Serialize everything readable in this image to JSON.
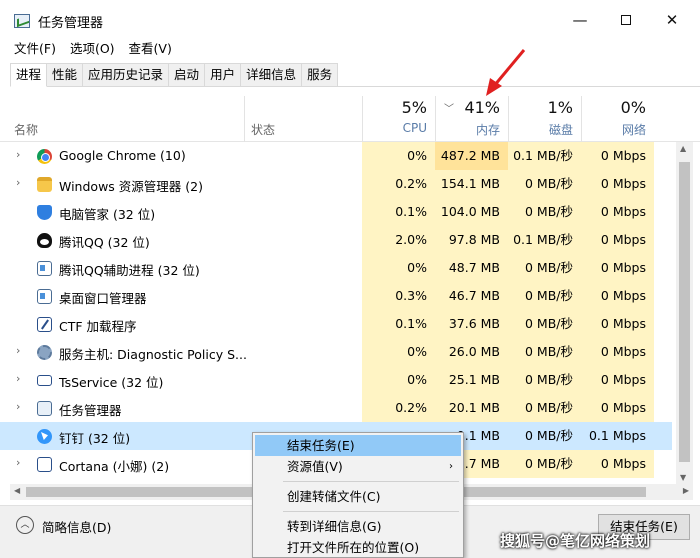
{
  "window": {
    "title": "任务管理器"
  },
  "menu": [
    "文件(F)",
    "选项(O)",
    "查看(V)"
  ],
  "tabs": [
    "进程",
    "性能",
    "应用历史记录",
    "启动",
    "用户",
    "详细信息",
    "服务"
  ],
  "columns": {
    "name": "名称",
    "status": "状态",
    "cpu": {
      "pct": "5%",
      "label": "CPU"
    },
    "memory": {
      "pct": "41%",
      "label": "内存"
    },
    "disk": {
      "pct": "1%",
      "label": "磁盘"
    },
    "network": {
      "pct": "0%",
      "label": "网络"
    }
  },
  "rows": [
    {
      "name": "Google Chrome (10)",
      "cpu": "0%",
      "mem": "487.2 MB",
      "disk": "0.1 MB/秒",
      "net": "0 Mbps",
      "icon": "chrome-icon"
    },
    {
      "name": "Windows 资源管理器 (2)",
      "cpu": "0.2%",
      "mem": "154.1 MB",
      "disk": "0 MB/秒",
      "net": "0 Mbps",
      "icon": "folder-icon"
    },
    {
      "name": "电脑管家 (32 位)",
      "cpu": "0.1%",
      "mem": "104.0 MB",
      "disk": "0 MB/秒",
      "net": "0 Mbps",
      "icon": "shield-icon"
    },
    {
      "name": "腾讯QQ (32 位)",
      "cpu": "2.0%",
      "mem": "97.8 MB",
      "disk": "0.1 MB/秒",
      "net": "0 Mbps",
      "icon": "qq-icon"
    },
    {
      "name": "腾讯QQ辅助进程 (32 位)",
      "cpu": "0%",
      "mem": "48.7 MB",
      "disk": "0 MB/秒",
      "net": "0 Mbps",
      "icon": "window-icon"
    },
    {
      "name": "桌面窗口管理器",
      "cpu": "0.3%",
      "mem": "46.7 MB",
      "disk": "0 MB/秒",
      "net": "0 Mbps",
      "icon": "window-icon"
    },
    {
      "name": "CTF 加载程序",
      "cpu": "0.1%",
      "mem": "37.6 MB",
      "disk": "0 MB/秒",
      "net": "0 Mbps",
      "icon": "pen-icon"
    },
    {
      "name": "服务主机: Diagnostic Policy S...",
      "cpu": "0%",
      "mem": "26.0 MB",
      "disk": "0 MB/秒",
      "net": "0 Mbps",
      "icon": "gear-icon"
    },
    {
      "name": "TsService (32 位)",
      "cpu": "0%",
      "mem": "25.1 MB",
      "disk": "0 MB/秒",
      "net": "0 Mbps",
      "icon": "monitor-icon"
    },
    {
      "name": "任务管理器",
      "cpu": "0.2%",
      "mem": "20.1 MB",
      "disk": "0 MB/秒",
      "net": "0 Mbps",
      "icon": "taskmgr-icon"
    },
    {
      "name": "钉钉 (32 位)",
      "cpu": "",
      "mem": "0.1 MB",
      "disk": "0 MB/秒",
      "net": "0.1 Mbps",
      "icon": "dingtalk-icon"
    },
    {
      "name": "Cortana (小娜) (2)",
      "cpu": "",
      "mem": "9.7 MB",
      "disk": "0 MB/秒",
      "net": "0 Mbps",
      "icon": "cortana-icon"
    }
  ],
  "context_menu": {
    "end_task": "结束任务(E)",
    "resource_values": "资源值(V)",
    "create_dump": "创建转储文件(C)",
    "go_to_details": "转到详细信息(G)",
    "open_file_location": "打开文件所在的位置(O)"
  },
  "footer": {
    "fewer_details": "简略信息(D)",
    "end_task_button": "结束任务(E)",
    "watermark": "搜狐号@笔亿网络策划"
  }
}
